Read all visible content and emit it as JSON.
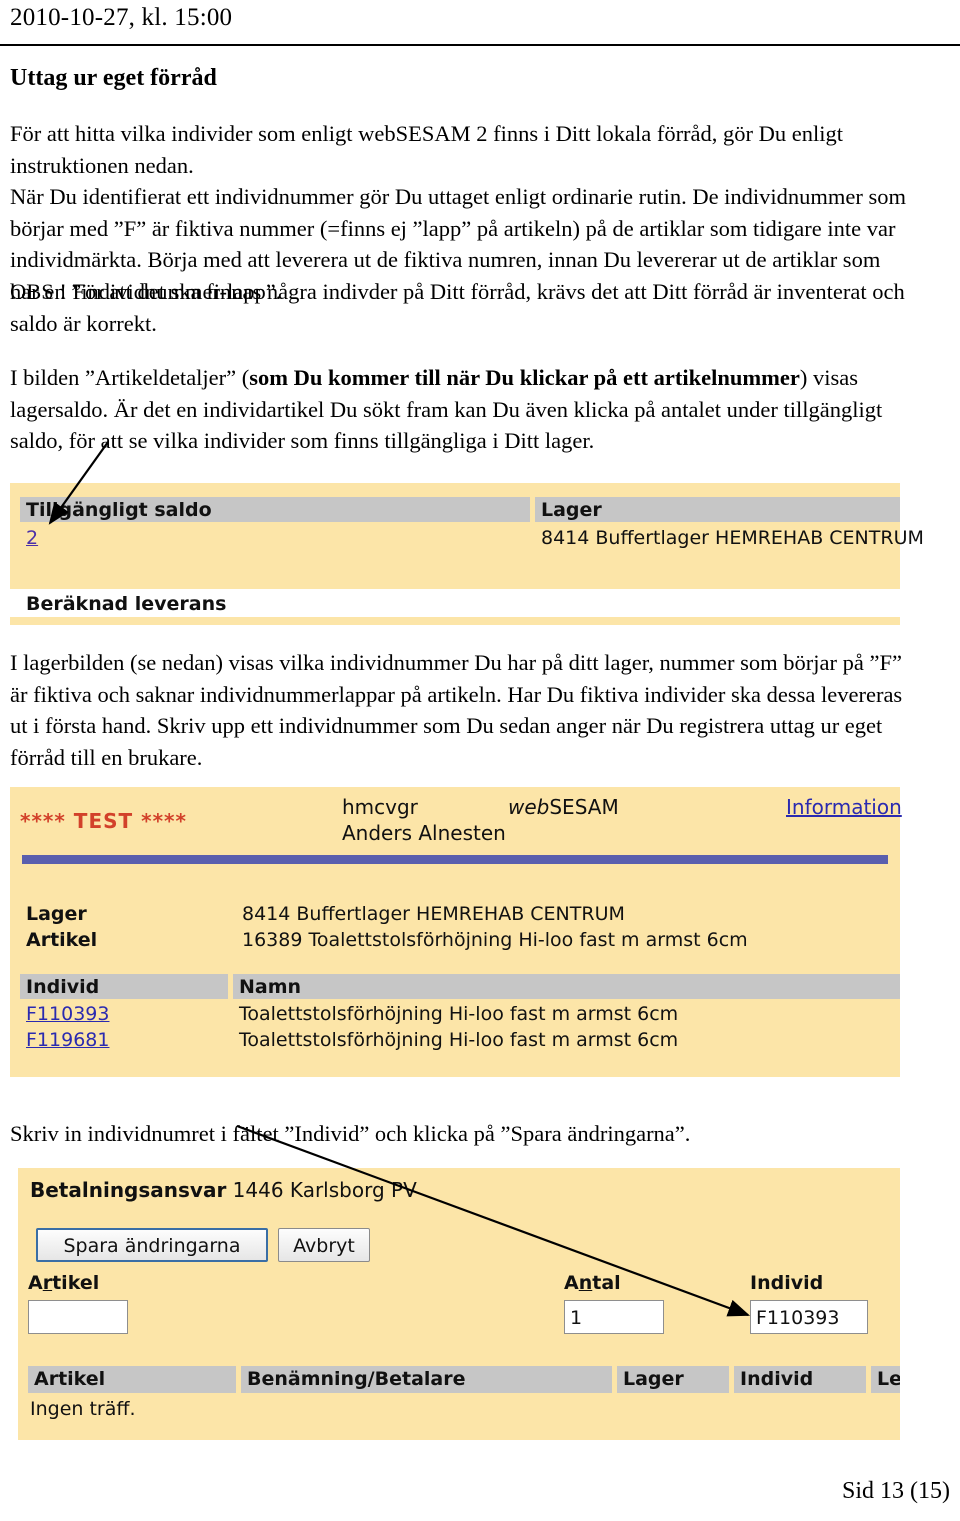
{
  "header": {
    "date": "2010-10-27, kl. 15:00",
    "title": "Uttag ur eget förråd"
  },
  "intro": {
    "p1": "För att hitta vilka individer som enligt webSESAM 2 finns i Ditt lokala förråd, gör Du enligt instruktionen nedan.",
    "p2_a": "När Du identifierat ett individnummer gör Du uttaget enligt ordinarie rutin. De individnummer som börjar med ”F” är fiktiva nummer (=finns ej ”lapp” på artikeln) på de artiklar som tidigare inte var individmärkta. Börja med att leverera ut de fiktiva numren, innan Du levererar ut de artiklar som har en ”individnummer-lapp”.",
    "p3": "OBS ! För att det ska finnas några indivder på Ditt förråd, krävs det att Ditt förråd är inventerat och saldo är korrekt."
  },
  "section_artikeldetaljer": {
    "lead_1": "I bilden ”Artikeldetaljer” (",
    "lead_bold": "som Du kommer till när Du klickar på ett artikelnummer",
    "lead_2": ") visas lagersaldo. Är det en individartikel Du sökt fram kan Du även klicka på antalet under tillgängligt saldo, för att se vilka individer som finns tillgängliga i Ditt lager."
  },
  "panel_artikeldetaljer": {
    "col_saldo_header": "Tillgängligt saldo",
    "col_lager_header": "Lager",
    "saldo_value": "2",
    "lager_value": "8414 Buffertlager HEMREHAB CENTRUM",
    "berkand_header": "Beräknad leverans"
  },
  "section_lagerbild": {
    "p": "I lagerbilden (se nedan) visas vilka individnummer Du har på ditt lager, nummer som börjar på ”F” är fiktiva och saknar individnummerlappar på artikeln. Har Du fiktiva individer ska dessa levereras ut i första hand. Skriv upp ett individnummer som Du sedan anger när Du registrera uttag ur eget förråd till en brukare."
  },
  "panel_lagerbild": {
    "test_marker": "**** TEST ****",
    "user_id": "hmcvgr",
    "user_name": "Anders Alnesten",
    "app_name_italic": "web",
    "app_name_rest": "SESAM",
    "information_link": "Information",
    "lager_label": "Lager",
    "lager_value": "8414 Buffertlager HEMREHAB CENTRUM",
    "artikel_label": "Artikel",
    "artikel_value": "16389 Toalettstolsförhöjning Hi-loo fast m armst 6cm",
    "col_individ_header": "Individ",
    "col_namn_header": "Namn",
    "rows": [
      {
        "individ": "F110393",
        "namn": "Toalettstolsförhöjning Hi-loo fast m armst 6cm"
      },
      {
        "individ": "F119681",
        "namn": "Toalettstolsförhöjning Hi-loo fast m armst 6cm"
      }
    ]
  },
  "section_spara": {
    "p": "Skriv in individnumret i fältet ”Individ” och klicka på ”Spara ändringarna”."
  },
  "panel_registrera": {
    "betalningsansvar_label": "Betalningsansvar",
    "betalningsansvar_value": "1446 Karlsborg PV",
    "save_button": "Spara ändringarna",
    "cancel_button": "Avbryt",
    "artikel_label_pre": "A",
    "artikel_label_accesskey": "r",
    "artikel_label_post": "tikel",
    "antal_label_pre": "A",
    "antal_label_accesskey": "n",
    "antal_label_post": "tal",
    "individ_label": "Individ",
    "artikel_input_value": "",
    "antal_input_value": "1",
    "individ_input_value": "F110393",
    "result_columns": [
      "Artikel",
      "Benämning/Betalare",
      "Lager",
      "Individ",
      "Lev.d"
    ],
    "result_empty": "Ingen träff."
  },
  "footer": {
    "page": "Sid 13  (15)"
  },
  "colors": {
    "panel_yellow": "#fce5a8",
    "header_gray": "#c6c6c6",
    "divider_purple": "#5a5fae",
    "test_red": "#d2412a",
    "link_purple": "#4b2fa8",
    "link_blue": "#2a2ab0"
  }
}
